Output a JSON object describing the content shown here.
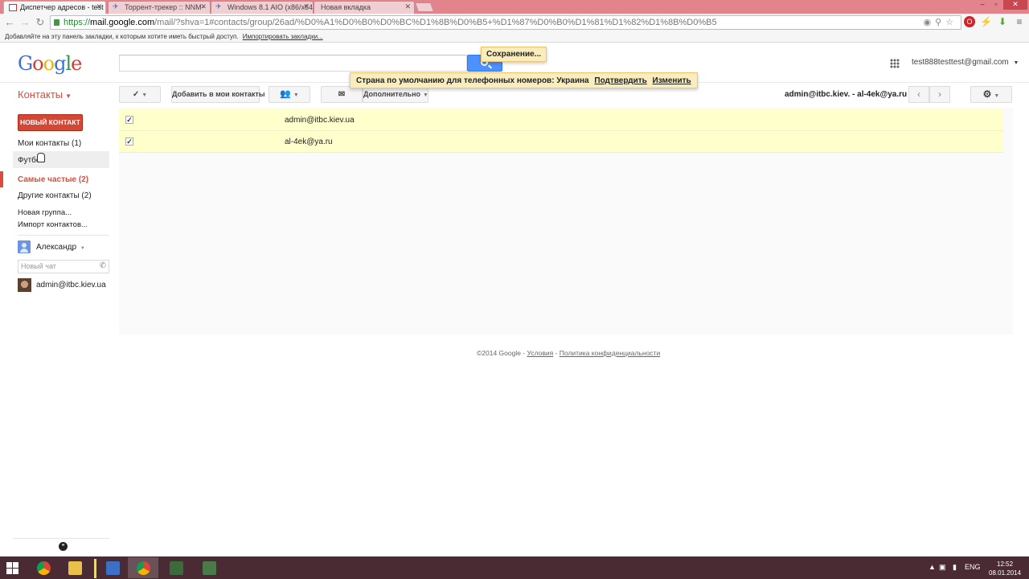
{
  "browser": {
    "tabs": [
      {
        "label": "Диспетчер адресов - test",
        "active": true
      },
      {
        "label": "Торрент-трекер :: NNM-",
        "active": false
      },
      {
        "label": "Windows 8.1 AIO (x86/x64",
        "active": false
      },
      {
        "label": "Новая вкладка",
        "active": false
      }
    ],
    "url_proto": "https://",
    "url_host": "mail.google.com",
    "url_path": "/mail/?shva=1#contacts/group/26ad/%D0%A1%D0%B0%D0%BC%D1%8B%D0%B5+%D1%87%D0%B0%D1%81%D1%82%D1%8B%D0%B5",
    "bookmarks_text": "Добавляйте на эту панель закладки, к которым хотите иметь быстрый доступ.",
    "bookmarks_link": "Импортировать закладки..."
  },
  "header": {
    "logo": [
      "G",
      "o",
      "o",
      "g",
      "l",
      "e"
    ],
    "saving": "Сохранение...",
    "account": "test888testtest@gmail.com",
    "notice_text": "Страна по умолчанию для телефонных номеров: Украина",
    "notice_confirm": "Подтвердить",
    "notice_change": "Изменить"
  },
  "contacts_title": "Контакты",
  "toolbar": {
    "add_to_my_contacts": "Добавить в мои контакты",
    "more": "Дополнительно",
    "range": "admin@itbc.kiev. - al-4ek@ya.ru"
  },
  "sidebar": {
    "new_contact": "НОВЫЙ КОНТАКТ",
    "items": [
      {
        "label": "Мои контакты (1)"
      },
      {
        "label": "Футбол"
      },
      {
        "label": "Самые частые (2)"
      },
      {
        "label": "Другие контакты (2)"
      },
      {
        "label": "Новая группа..."
      },
      {
        "label": "Импорт контактов..."
      }
    ],
    "chat_user": "Александр",
    "chat_placeholder": "Новый чат",
    "chat_friend": "admin@itbc.kiev.ua"
  },
  "contacts": [
    {
      "email": "admin@itbc.kiev.ua",
      "checked": true
    },
    {
      "email": "al-4ek@ya.ru",
      "checked": true
    }
  ],
  "footer": {
    "copyright": "©2014 Google - ",
    "terms": "Условия",
    "sep": " - ",
    "privacy": "Политика конфиденциальности"
  },
  "taskbar": {
    "lang": "ENG",
    "time": "12:52",
    "date": "08.01.2014"
  },
  "colors": {
    "accent_red": "#dd4b39",
    "selected_row": "#ffffcc",
    "notice_bg": "#f9edbe",
    "search_blue": "#4d90fe"
  }
}
